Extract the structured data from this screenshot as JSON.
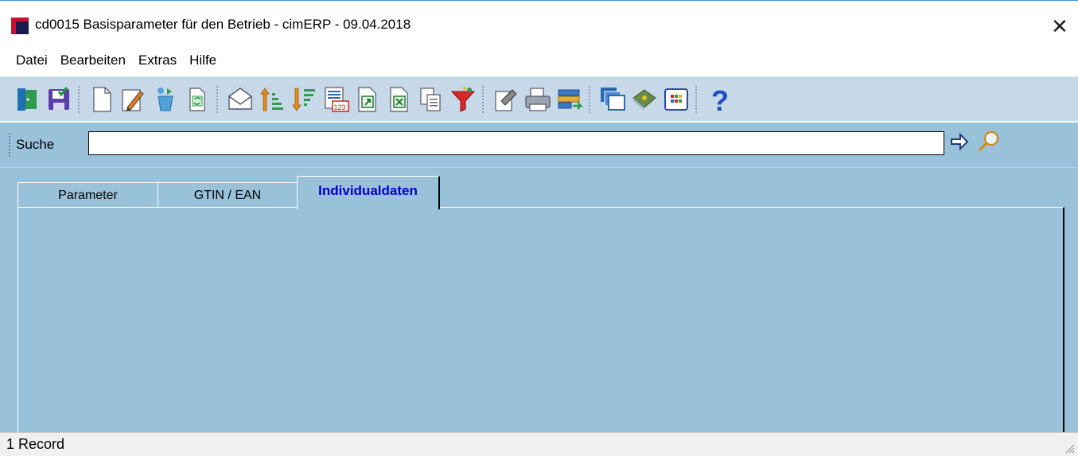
{
  "window": {
    "title": "cd0015 Basisparameter für den Betrieb - cimERP - 09.04.2018",
    "close_label": "✕"
  },
  "menubar": {
    "items": [
      {
        "label": "Datei"
      },
      {
        "label": "Bearbeiten"
      },
      {
        "label": "Extras"
      },
      {
        "label": "Hilfe"
      }
    ]
  },
  "toolbar": {
    "buttons": [
      {
        "icon": "exit-door-icon"
      },
      {
        "icon": "save-icon"
      },
      {
        "icon": "new-document-icon"
      },
      {
        "icon": "edit-icon"
      },
      {
        "icon": "recycle-icon"
      },
      {
        "icon": "refresh-icon"
      },
      {
        "icon": "mail-icon"
      },
      {
        "icon": "sort-ascending-icon"
      },
      {
        "icon": "sort-descending-icon"
      },
      {
        "icon": "numbered-list-icon"
      },
      {
        "icon": "export-icon"
      },
      {
        "icon": "excel-icon"
      },
      {
        "icon": "copy-icon"
      },
      {
        "icon": "filter-icon"
      },
      {
        "icon": "properties-icon"
      },
      {
        "icon": "print-icon"
      },
      {
        "icon": "transfer-icon"
      },
      {
        "icon": "windows-icon"
      },
      {
        "icon": "book-icon"
      },
      {
        "icon": "grid-icon"
      },
      {
        "icon": "help-icon"
      }
    ]
  },
  "search": {
    "label": "Suche",
    "value": ""
  },
  "tabs": [
    {
      "label": "Parameter",
      "active": false
    },
    {
      "label": "GTIN / EAN",
      "active": false
    },
    {
      "label": "Individualdaten",
      "active": true
    }
  ],
  "status": {
    "text": "1 Record"
  },
  "colors": {
    "toolbar_bg": "#c7d8e8",
    "content_bg": "#99c2da",
    "active_tab_text": "#0000c8"
  }
}
